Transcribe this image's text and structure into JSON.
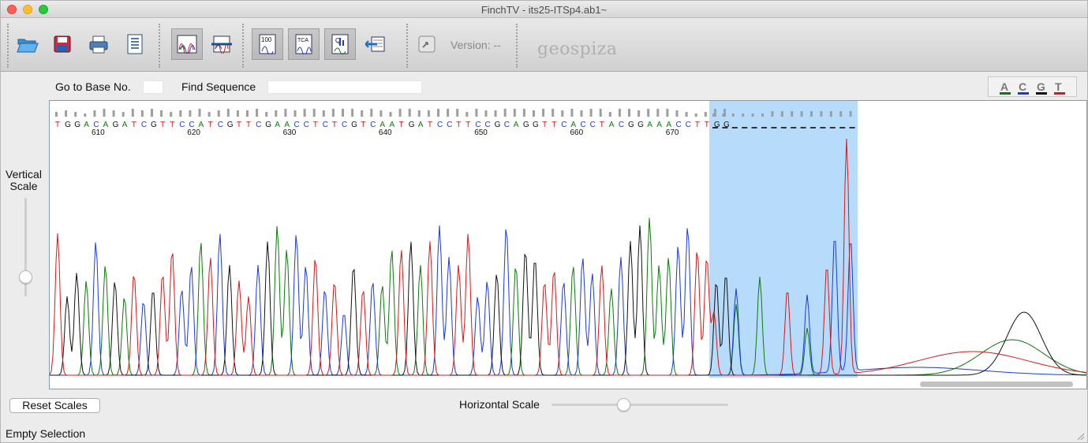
{
  "window": {
    "title": "FinchTV - its25-ITSp4.ab1~"
  },
  "toolbar": {
    "buttons": [
      {
        "name": "open-icon"
      },
      {
        "name": "save-icon"
      },
      {
        "name": "print-icon"
      },
      {
        "name": "info-icon"
      },
      {
        "name": "trace-view-icon"
      },
      {
        "name": "multi-trace-icon"
      },
      {
        "name": "quality-100-icon"
      },
      {
        "name": "tca-icon"
      },
      {
        "name": "quality-values-icon"
      },
      {
        "name": "export-icon"
      },
      {
        "name": "update-icon"
      }
    ],
    "version_label": "Version: --",
    "logo_text": "geospiza"
  },
  "navigation": {
    "goto_label": "Go to Base No.",
    "goto_value": "",
    "find_label": "Find Sequence",
    "find_value": ""
  },
  "bases_legend": [
    {
      "letter": "A",
      "color": "#0a7a0a"
    },
    {
      "letter": "C",
      "color": "#1a3ad6"
    },
    {
      "letter": "G",
      "color": "#111111"
    },
    {
      "letter": "T",
      "color": "#d81818"
    }
  ],
  "vertical_scale": {
    "label_line1": "Vertical",
    "label_line2": "Scale"
  },
  "sequence": {
    "called_bases": "TGGACAGATCGTTCCATCGTTCGAACCTCTCGTCAATGATCCTTCCGCAGGTTCACCTACGGAAACCTTG",
    "position_labels": [
      "610",
      "620",
      "630",
      "640",
      "650",
      "660",
      "670"
    ],
    "selection_start_base": "G"
  },
  "controls": {
    "reset_label": "Reset Scales",
    "hscale_label": "Horizontal Scale"
  },
  "status": {
    "text": "Empty Selection"
  }
}
